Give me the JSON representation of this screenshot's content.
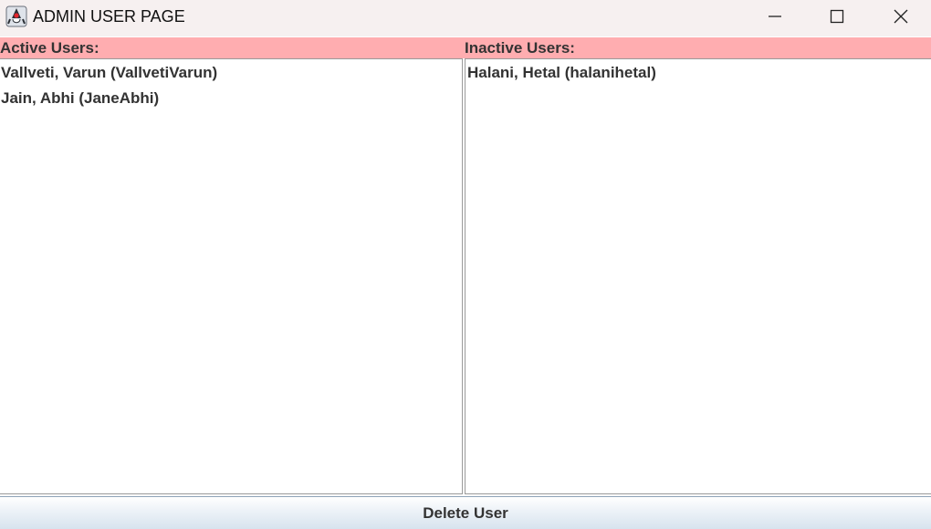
{
  "window": {
    "title": "ADMIN USER PAGE",
    "app_icon": "java-duke-icon",
    "controls": [
      "minimize-icon",
      "maximize-icon",
      "close-icon"
    ]
  },
  "active_panel": {
    "label": "Active Users:",
    "users": [
      "Vallveti, Varun (VallvetiVarun)",
      "Jain, Abhi (JaneAbhi)"
    ]
  },
  "inactive_panel": {
    "label": "Inactive Users:",
    "users": [
      "Halani, Hetal (halanihetal)"
    ]
  },
  "actions": {
    "delete_label": "Delete User"
  },
  "colors": {
    "header_strip": "#ffadb0",
    "titlebar": "#f6f0f0"
  }
}
